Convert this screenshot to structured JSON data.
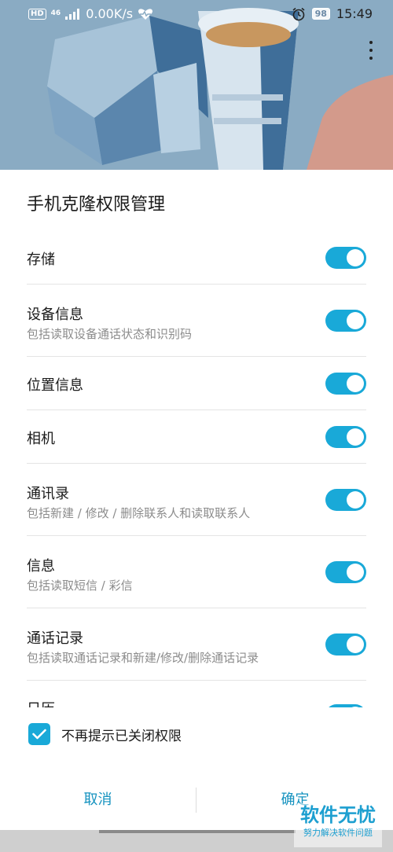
{
  "status_bar": {
    "hd_badge": "HD",
    "network": "46",
    "speed": "0.00K/s",
    "battery": "98",
    "time": "15:49",
    "icons": [
      "hd-icon",
      "signal-icon",
      "heart-rate-icon",
      "alarm-icon",
      "battery-icon"
    ]
  },
  "dialog": {
    "title": "手机克隆权限管理",
    "permissions": [
      {
        "label": "存储",
        "desc": "",
        "enabled": true
      },
      {
        "label": "设备信息",
        "desc": "包括读取设备通话状态和识别码",
        "enabled": true
      },
      {
        "label": "位置信息",
        "desc": "",
        "enabled": true
      },
      {
        "label": "相机",
        "desc": "",
        "enabled": true
      },
      {
        "label": "通讯录",
        "desc": "包括新建 / 修改 / 删除联系人和读取联系人",
        "enabled": true
      },
      {
        "label": "信息",
        "desc": "包括读取短信 / 彩信",
        "enabled": true
      },
      {
        "label": "通话记录",
        "desc": "包括读取通话记录和新建/修改/删除通话记录",
        "enabled": true
      },
      {
        "label": "日历",
        "desc": "",
        "enabled": true
      }
    ],
    "dont_show_again": {
      "label": "不再提示已关闭权限",
      "checked": true
    },
    "cancel_label": "取消",
    "confirm_label": "确定"
  },
  "watermark": {
    "title": "软件无忧",
    "subtitle": "努力解决软件问题"
  },
  "colors": {
    "accent": "#19a9d8",
    "button_text": "#1492bf",
    "hero_bg": "#8aabc3"
  }
}
